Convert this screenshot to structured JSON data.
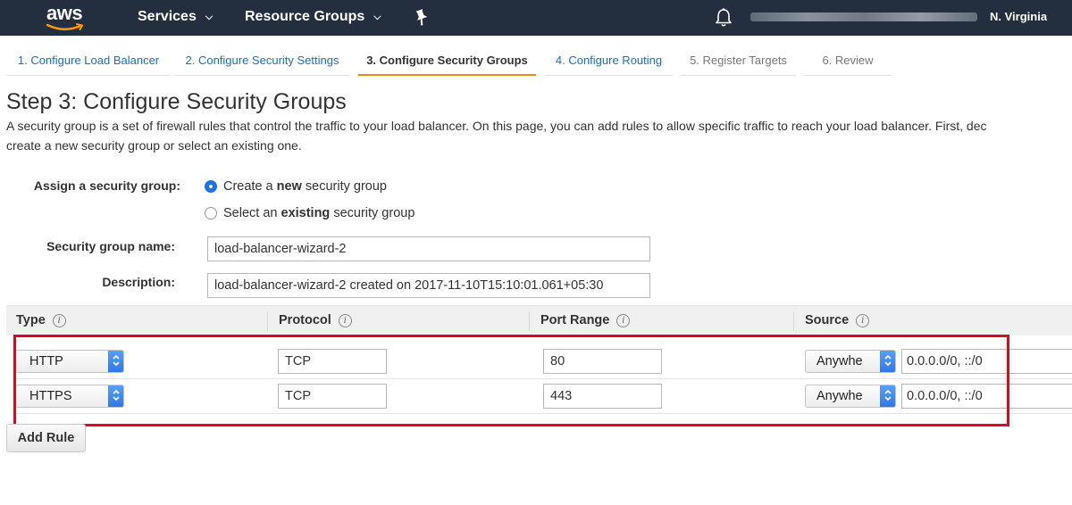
{
  "nav": {
    "logo_text": "aws",
    "services_label": "Services",
    "resource_groups_label": "Resource Groups",
    "region_label": "N. Virginia",
    "colors": {
      "background": "#232f3e",
      "smile": "#ff9900"
    }
  },
  "wizard_tabs": [
    {
      "label": "1. Configure Load Balancer",
      "state": "link"
    },
    {
      "label": "2. Configure Security Settings",
      "state": "link"
    },
    {
      "label": "3. Configure Security Groups",
      "state": "active"
    },
    {
      "label": "4. Configure Routing",
      "state": "link"
    },
    {
      "label": "5. Register Targets",
      "state": "disabled"
    },
    {
      "label": "6. Review",
      "state": "disabled"
    }
  ],
  "page": {
    "title": "Step 3: Configure Security Groups",
    "description_line1": "A security group is a set of firewall rules that control the traffic to your load balancer. On this page, you can add rules to allow specific traffic to reach your load balancer. First, dec",
    "description_line2": "create a new security group or select an existing one."
  },
  "form": {
    "assign_label": "Assign a security group:",
    "option_new": {
      "pre": "Create a ",
      "bold": "new",
      "post": " security group",
      "checked": true
    },
    "option_existing": {
      "pre": "Select an ",
      "bold": "existing",
      "post": " security group",
      "checked": false
    },
    "name_label": "Security group name:",
    "name_value": "load-balancer-wizard-2",
    "description_label": "Description:",
    "description_value": "load-balancer-wizard-2 created on 2017-11-10T15:10:01.061+05:30"
  },
  "rules_table": {
    "headers": {
      "type": "Type",
      "protocol": "Protocol",
      "port_range": "Port Range",
      "source": "Source"
    },
    "info_glyph": "i",
    "rows": [
      {
        "type": "HTTP",
        "protocol": "TCP",
        "port_range": "80",
        "source_select": "Anywhe",
        "source_cidr": "0.0.0.0/0, ::/0"
      },
      {
        "type": "HTTPS",
        "protocol": "TCP",
        "port_range": "443",
        "source_select": "Anywhe",
        "source_cidr": "0.0.0.0/0, ::/0"
      }
    ],
    "highlight_color": "#e0071b"
  },
  "actions": {
    "add_rule_label": "Add Rule"
  }
}
